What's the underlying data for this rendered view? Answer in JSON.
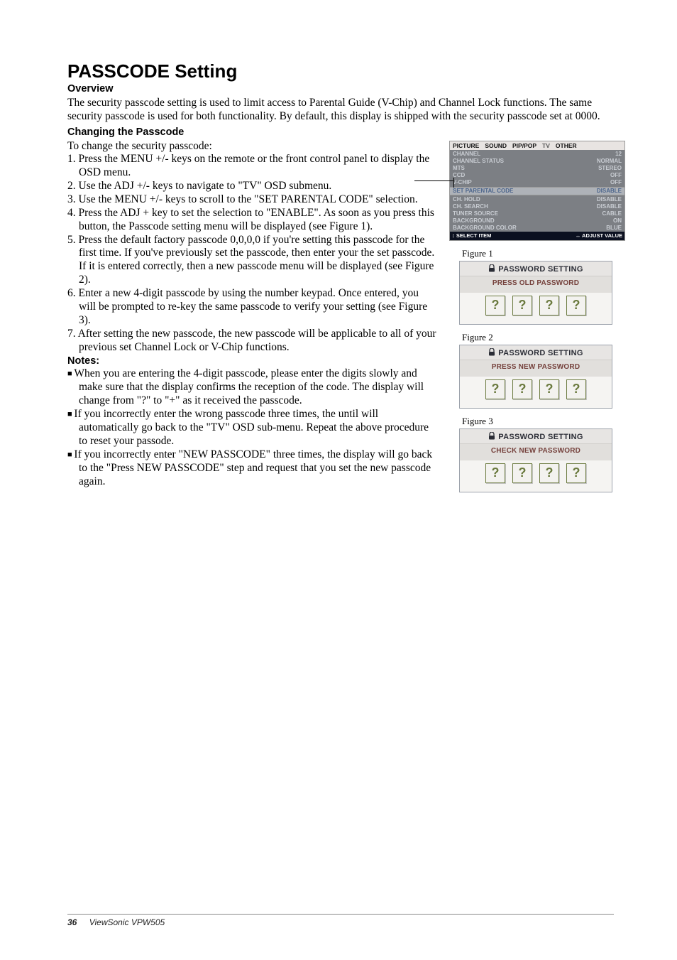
{
  "title": "PASSCODE Setting",
  "overview_head": "Overview",
  "overview_text": "The security passcode setting is used to limit access to Parental Guide  (V-Chip) and Channel Lock functions.  The same security passcode is used for both functionality.  By default, this display is shipped with the security passcode set at 0000.",
  "changing_head": "Changing the Passcode",
  "changing_intro": "To change the security passcode:",
  "steps": [
    "1. Press the MENU +/- keys on the remote or the front control panel to display the OSD menu.",
    "2. Use the ADJ +/- keys to navigate to \"TV\" OSD submenu.",
    "3. Use the MENU +/- keys to scroll to the \"SET PARENTAL CODE\" selection.",
    "4. Press the ADJ + key to set the selection to \"ENABLE\".  As soon as you press this button, the Passcode setting menu will be displayed (see Figure 1).",
    "5. Press the default factory passcode 0,0,0,0 if you're setting this passcode for the first time.  If you've previously set the passcode, then enter your the set passcode.  If it is entered correctly, then a new passcode menu will be displayed (see Figure 2).",
    "6. Enter a new 4-digit passcode by using the number keypad.  Once entered, you will be prompted to re-key the same passcode to verify your setting (see Figure 3).",
    "7. After setting the new passcode, the new passcode will be applicable to all of your previous set Channel Lock or V-Chip functions."
  ],
  "notes_head": "Notes:",
  "notes": [
    "When you are entering the 4-digit passcode, please enter the digits slowly and make sure that the display confirms the reception of the code.  The display will change from \"?\" to \"+\" as it received the passcode.",
    "If you incorrectly enter the wrong passcode three times, the until will automatically go back to the \"TV\" OSD sub-menu.  Repeat the above procedure to reset your passode.",
    "If you incorrectly enter \"NEW PASSCODE\" three times, the display will go back to the \"Press NEW PASSCODE\" step and request that you set the new passcode again."
  ],
  "osd": {
    "tabs": [
      "PICTURE",
      "SOUND",
      "PIP/POP",
      "TV",
      "OTHER"
    ],
    "rows": [
      {
        "l": "CHANNEL",
        "r": "12"
      },
      {
        "l": "CHANNEL STATUS",
        "r": "NORMAL"
      },
      {
        "l": "MTS",
        "r": "STEREO"
      },
      {
        "l": "CCD",
        "r": "OFF"
      },
      {
        "l": "V-CHIP",
        "r": "OFF"
      }
    ],
    "highlight": {
      "l": "SET PARENTAL CODE",
      "r": "DISABLE"
    },
    "rows2": [
      {
        "l": "CH. HOLD",
        "r": "DISABLE"
      },
      {
        "l": "CH. SEARCH",
        "r": "DISABLE"
      },
      {
        "l": "TUNER SOURCE",
        "r": "CABLE"
      },
      {
        "l": "BACKGROUND",
        "r": "ON"
      },
      {
        "l": "BACKGROUND COLOR",
        "r": "BLUE"
      }
    ],
    "footer_l": "↕ SELECT ITEM",
    "footer_r": "↔ ADJUST VALUE"
  },
  "figures": {
    "f1_label": "Figure 1",
    "f2_label": "Figure 2",
    "f3_label": "Figure 3",
    "pw_head": "PASSWORD SETTING",
    "f1_sub": "PRESS OLD PASSWORD",
    "f2_sub": "PRESS NEW PASSWORD",
    "f3_sub": "CHECK NEW PASSWORD",
    "digit_char": "?"
  },
  "footer": {
    "page": "36",
    "product": "ViewSonic  VPW505"
  }
}
